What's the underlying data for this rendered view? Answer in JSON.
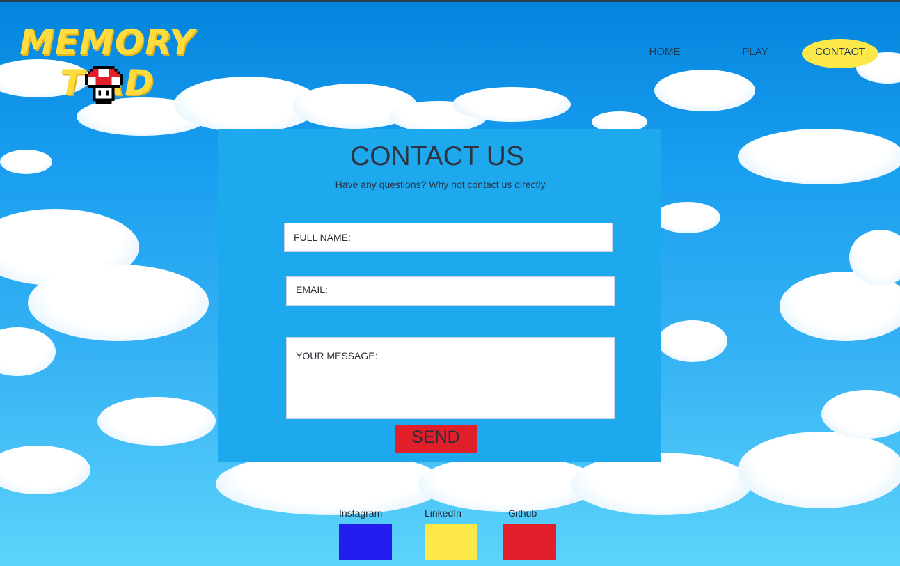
{
  "brand": {
    "line1": "MEMORY",
    "line2": "T  AD",
    "mascot_icon": "mushroom-icon"
  },
  "nav": {
    "items": [
      {
        "label": "HOME"
      },
      {
        "label": "PLAY"
      },
      {
        "label": "CONTACT"
      }
    ],
    "active": "CONTACT",
    "active_color": "#fde84a"
  },
  "contact": {
    "title": "CONTACT US",
    "subtitle": "Have any questions? Why not contact us directly.",
    "fields": {
      "name_placeholder": "FULL NAME:",
      "email_placeholder": "EMAIL:",
      "message_placeholder": "YOUR MESSAGE:"
    },
    "send_label": "SEND",
    "send_color": "#e11f2b",
    "panel_color": "#1ea9ef"
  },
  "social": [
    {
      "label": "Instagram",
      "color": "#231df0"
    },
    {
      "label": "LinkedIn",
      "color": "#fde84a"
    },
    {
      "label": "Github",
      "color": "#e11f2b"
    }
  ]
}
